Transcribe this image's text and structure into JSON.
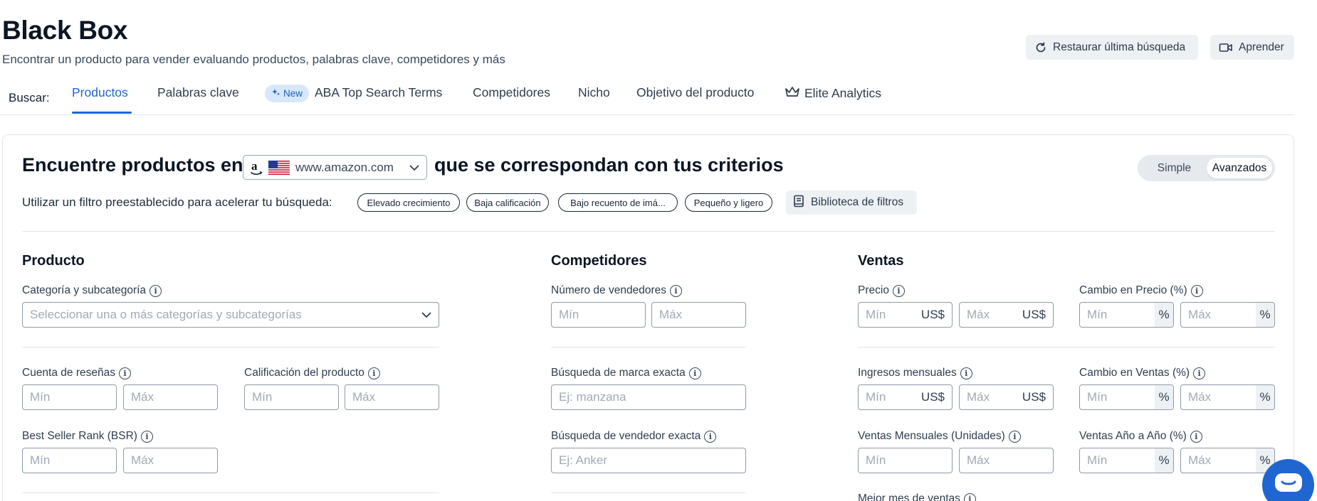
{
  "header": {
    "title": "Black Box",
    "subtitle": "Encontrar un producto para vender evaluando productos, palabras clave, competidores y más",
    "restore_label": "Restaurar última búsqueda",
    "learn_label": "Aprender"
  },
  "tabs": {
    "prefix": "Buscar:",
    "items": [
      "Productos",
      "Palabras clave",
      "ABA Top Search Terms",
      "Competidores",
      "Nicho",
      "Objetivo del producto",
      "Elite Analytics"
    ],
    "new_badge": "New",
    "active": "Productos"
  },
  "card": {
    "headline_start": "Encuentre productos en",
    "marketplace": "www.amazon.com",
    "headline_end": "que se correspondan con tus criterios",
    "mode_simple": "Simple",
    "mode_advanced": "Avanzados",
    "preset_label": "Utilizar un filtro preestablecido para acelerar tu búsqueda:",
    "presets": [
      "Elevado crecimiento",
      "Baja calificación",
      "Bajo recuento de imá...",
      "Pequeño y ligero"
    ],
    "library_label": "Biblioteca de filtros"
  },
  "product": {
    "title": "Producto",
    "category_label": "Categoría y subcategoría",
    "category_placeholder": "Seleccionar una o más categorías y subcategorías",
    "reviews_label": "Cuenta de reseñas",
    "rating_label": "Calificación del producto",
    "bsr_label": "Best Seller Rank (BSR)"
  },
  "competitors": {
    "title": "Competidores",
    "sellers_label": "Número de vendedores",
    "brand_label": "Búsqueda de marca exacta",
    "brand_placeholder": "Ej: manzana",
    "seller_label": "Búsqueda de vendedor exacta",
    "seller_placeholder": "Ej: Anker"
  },
  "sales": {
    "title": "Ventas",
    "price_label": "Precio",
    "price_change_label": "Cambio en Precio (%)",
    "revenue_label": "Ingresos mensuales",
    "sales_change_label": "Cambio en Ventas (%)",
    "units_label": "Ventas Mensuales (Unidades)",
    "yoy_label": "Ventas Año a Año (%)",
    "best_month_label": "Mejor mes de ventas"
  },
  "common": {
    "min": "Mín",
    "max": "Máx",
    "currency": "US$",
    "percent": "%",
    "info_glyph": "i"
  },
  "colors": {
    "accent": "#1f66d1",
    "badge_bg": "#d7e8fb",
    "button_bg": "#eef1f4"
  }
}
